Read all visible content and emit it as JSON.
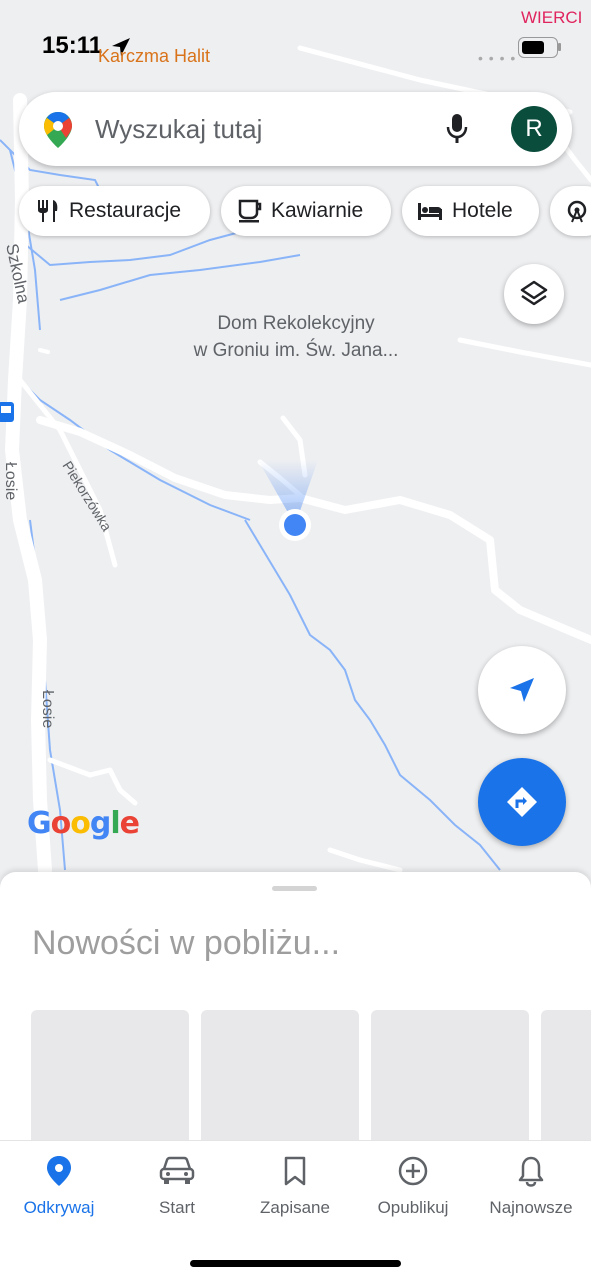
{
  "status_bar": {
    "time": "15:11",
    "place_text": "Karczma Halit",
    "corner_text": "WIERCI"
  },
  "search": {
    "placeholder": "Wyszukaj tutaj",
    "avatar_letter": "R"
  },
  "chips": [
    {
      "label": "Restauracje",
      "icon": "fork-knife-icon"
    },
    {
      "label": "Kawiarnie",
      "icon": "coffee-cup-icon"
    },
    {
      "label": "Hotele",
      "icon": "bed-icon"
    },
    {
      "label": "",
      "icon": "ferris-wheel-icon"
    }
  ],
  "map": {
    "place_label_line1": "Dom Rekolekcyjny",
    "place_label_line2": "w Groniu im. Św. Jana...",
    "streets": [
      "Szkolna",
      "Piekorzówka",
      "Łosie",
      "Łosie"
    ],
    "logo_text": "Google",
    "colors": {
      "water": "#8ab4f8",
      "road": "#ffffff",
      "land": "#eeeff1",
      "location_dot": "#4285f4",
      "directions_fab": "#1a73e8"
    }
  },
  "sheet": {
    "title": "Nowości w pobliżu..."
  },
  "bottom_nav": [
    {
      "label": "Odkrywaj",
      "icon": "location-pin-icon",
      "active": true
    },
    {
      "label": "Start",
      "icon": "car-icon",
      "active": false
    },
    {
      "label": "Zapisane",
      "icon": "bookmark-icon",
      "active": false
    },
    {
      "label": "Opublikuj",
      "icon": "plus-circle-icon",
      "active": false
    },
    {
      "label": "Najnowsze",
      "icon": "bell-icon",
      "active": false
    }
  ]
}
